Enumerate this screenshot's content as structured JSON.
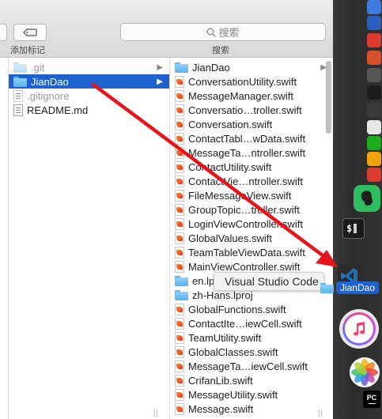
{
  "toolbar": {
    "tag_label": "添加标记",
    "search_placeholder": "搜索",
    "search_label": "搜索"
  },
  "column_middle": {
    "items": [
      {
        "name": ".git",
        "kind": "folder",
        "dim": true,
        "has_children": true
      },
      {
        "name": "JianDao",
        "kind": "folder",
        "dim": false,
        "selected": true,
        "has_children": true
      },
      {
        "name": ".gitignore",
        "kind": "file",
        "dim": true
      },
      {
        "name": "README.md",
        "kind": "file",
        "dim": false
      }
    ]
  },
  "column_right": {
    "items": [
      {
        "name": "JianDao",
        "kind": "folder",
        "has_children": true
      },
      {
        "name": "ConversationUtility.swift",
        "kind": "swift"
      },
      {
        "name": "MessageManager.swift",
        "kind": "swift"
      },
      {
        "name": "Conversatio…troller.swift",
        "kind": "swift"
      },
      {
        "name": "Conversation.swift",
        "kind": "swift"
      },
      {
        "name": "ContactTabl…wData.swift",
        "kind": "swift"
      },
      {
        "name": "MessageTa…ntroller.swift",
        "kind": "swift"
      },
      {
        "name": "ContactUtility.swift",
        "kind": "swift"
      },
      {
        "name": "ContactVie…ntroller.swift",
        "kind": "swift"
      },
      {
        "name": "FileMessageView.swift",
        "kind": "swift"
      },
      {
        "name": "GroupTopic…troller.swift",
        "kind": "swift"
      },
      {
        "name": "LoginViewController.swift",
        "kind": "swift"
      },
      {
        "name": "GlobalValues.swift",
        "kind": "swift"
      },
      {
        "name": "TeamTableViewData.swift",
        "kind": "swift"
      },
      {
        "name": "MainViewController.swift",
        "kind": "swift"
      },
      {
        "name": "en.lproj",
        "kind": "folder"
      },
      {
        "name": "zh-Hans.lproj",
        "kind": "folder"
      },
      {
        "name": "GlobalFunctions.swift",
        "kind": "swift"
      },
      {
        "name": "ContactIte…iewCell.swift",
        "kind": "swift"
      },
      {
        "name": "TeamUtility.swift",
        "kind": "swift"
      },
      {
        "name": "GlobalClasses.swift",
        "kind": "swift"
      },
      {
        "name": "MessageTa…iewCell.swift",
        "kind": "swift"
      },
      {
        "name": "CrifanLib.swift",
        "kind": "swift"
      },
      {
        "name": "MessageUtility.swift",
        "kind": "swift"
      },
      {
        "name": "Message.swift",
        "kind": "swift"
      }
    ]
  },
  "drag": {
    "target_app_label": "Visual Studio Code",
    "dragged_item": "JianDao"
  },
  "dock": {
    "apps": [
      {
        "name": "Evernote",
        "icon": "evernote-icon",
        "color": "#2dbe60"
      },
      {
        "name": "Terminal",
        "icon": "terminal-icon",
        "color": "#1a1a1a"
      },
      {
        "name": "Visual Studio Code",
        "icon": "vscode-icon",
        "color": "#1f6fb8"
      },
      {
        "name": "iTunes",
        "icon": "itunes-icon",
        "color": "#ffffff"
      },
      {
        "name": "Photos",
        "icon": "photos-icon",
        "color": "#ffffff"
      },
      {
        "name": "PyCharm",
        "icon": "pycharm-icon",
        "color": "#000000"
      }
    ],
    "terminal_glyph": "$"
  },
  "colors": {
    "selection": "#1e62d0",
    "arrow": "#e8141c",
    "folder": "#5ab2ee"
  }
}
